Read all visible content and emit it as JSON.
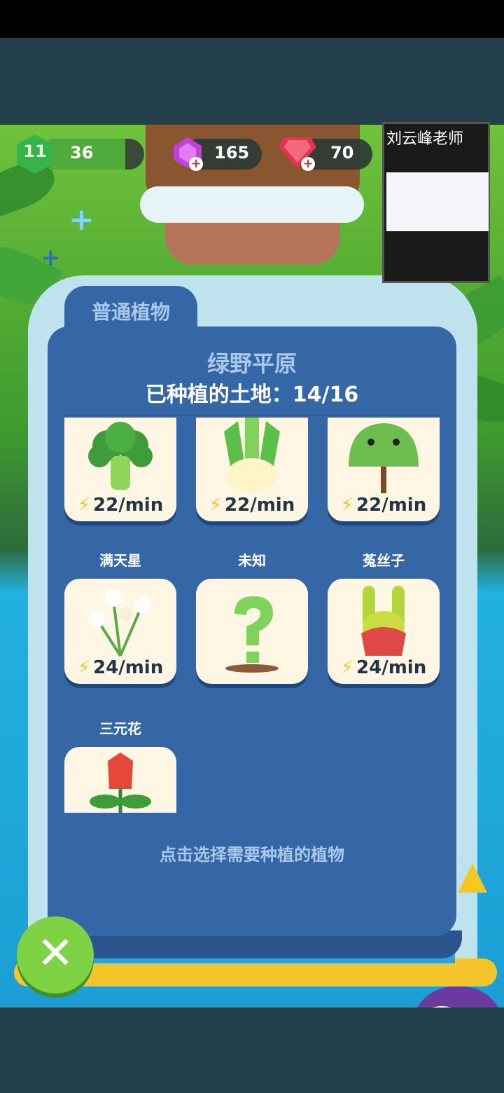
{
  "stats": {
    "level": "11",
    "xp": "36",
    "xp_fill": 0.8,
    "purple_gems": "165",
    "red_gems": "70"
  },
  "webcam": {
    "label": "刘云峰老师"
  },
  "jar": {
    "tab_label": "普通植物",
    "region_title": "绿野平原",
    "planted_text": "已种植的土地：14/16",
    "hint": "点击选择需要种植的植物"
  },
  "plants": [
    {
      "name": "",
      "rate": "22/min",
      "icon": "broccoli-plant"
    },
    {
      "name": "",
      "rate": "22/min",
      "icon": "leek-plant"
    },
    {
      "name": "",
      "rate": "22/min",
      "icon": "tree-plant"
    },
    {
      "name": "满天星",
      "rate": "24/min",
      "icon": "babys-breath-plant"
    },
    {
      "name": "未知",
      "rate": "",
      "icon": "unknown-question-plant"
    },
    {
      "name": "菟丝子",
      "rate": "24/min",
      "icon": "dodder-plant"
    },
    {
      "name": "三元花",
      "rate": "",
      "icon": "red-flower-plant"
    }
  ],
  "colors": {
    "panel": "#3566a6",
    "card": "#fff7e3",
    "energy": "#f4c81d",
    "close_button": "#7fd243"
  }
}
